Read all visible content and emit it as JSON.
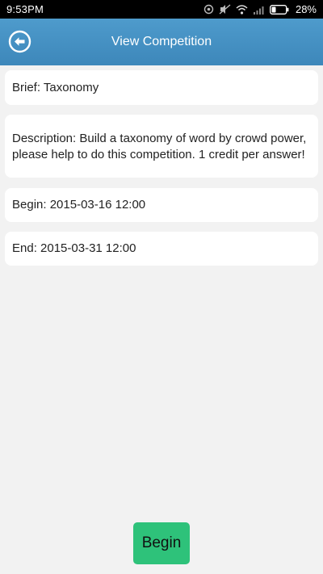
{
  "status_bar": {
    "time": "9:53PM",
    "battery": "28%",
    "icons": [
      "alarm-icon",
      "mute-icon",
      "wifi-icon",
      "signal-icon",
      "battery-icon"
    ]
  },
  "header": {
    "title": "View Competition",
    "back_icon": "back-arrow-icon",
    "color": "#4592c3"
  },
  "competition": {
    "brief": "Brief: Taxonomy",
    "description": "Description: Build a taxonomy of word by crowd power, please help to do this competition. 1 credit per answer!",
    "begin": "Begin: 2015-03-16 12:00",
    "end": "End: 2015-03-31 12:00"
  },
  "actions": {
    "begin_label": "Begin",
    "begin_color": "#2ec27a"
  }
}
